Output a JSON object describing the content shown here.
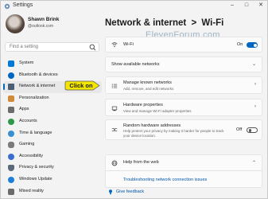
{
  "window": {
    "title": "Settings"
  },
  "user": {
    "name": "Shawn Brink",
    "email": "@outlook.com"
  },
  "search": {
    "placeholder": "Find a setting"
  },
  "sidebar": {
    "items": [
      {
        "label": "System",
        "icon": "monitor-icon",
        "color": "#0078d4"
      },
      {
        "label": "Bluetooth & devices",
        "icon": "bluetooth-icon",
        "color": "#0067c0"
      },
      {
        "label": "Network & internet",
        "icon": "network-icon",
        "color": "#4a5f76",
        "selected": true
      },
      {
        "label": "Personalization",
        "icon": "brush-icon",
        "color": "#d08a3a"
      },
      {
        "label": "Apps",
        "icon": "apps-icon",
        "color": "#6b6b6b"
      },
      {
        "label": "Accounts",
        "icon": "person-icon",
        "color": "#2b9a4a"
      },
      {
        "label": "Time & language",
        "icon": "globe-clock-icon",
        "color": "#3a8fd1"
      },
      {
        "label": "Gaming",
        "icon": "gamepad-icon",
        "color": "#7a7a7a"
      },
      {
        "label": "Accessibility",
        "icon": "accessibility-icon",
        "color": "#3a6fd1"
      },
      {
        "label": "Privacy & security",
        "icon": "shield-icon",
        "color": "#5a6a7a"
      },
      {
        "label": "Windows Update",
        "icon": "update-icon",
        "color": "#1f7fd6"
      },
      {
        "label": "Mixed reality",
        "icon": "headset-icon",
        "color": "#6b6b6b"
      }
    ]
  },
  "header": {
    "breadcrumb_parent": "Network & internet",
    "separator": ">",
    "current": "Wi-Fi"
  },
  "watermark": "ElevenForum.com",
  "wifi": {
    "label": "Wi-Fi",
    "state": "On"
  },
  "available": {
    "label": "Show available networks"
  },
  "known": {
    "title": "Manage known networks",
    "subtitle": "Add, remove, and edit networks"
  },
  "hardware": {
    "title": "Hardware properties",
    "subtitle": "View and manage Wi-Fi adapter properties"
  },
  "random": {
    "title": "Random hardware addresses",
    "subtitle": "Help protect your privacy by making it harder for people to track your device location.",
    "state": "Off"
  },
  "help": {
    "title": "Help from the web",
    "link": "Troubleshooting network connection issues"
  },
  "feedback": {
    "label": "Give feedback"
  },
  "callout": {
    "text": "Click on",
    "color": "#f2e600"
  },
  "accent": "#0067c0"
}
